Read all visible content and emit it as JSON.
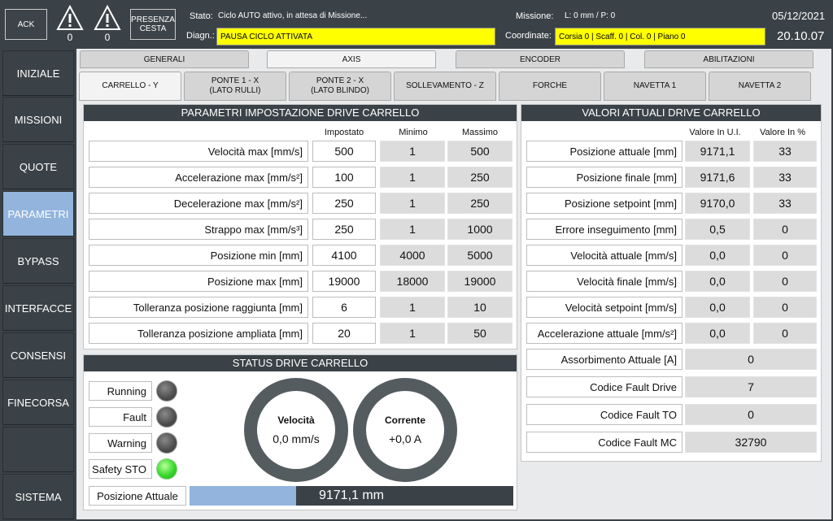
{
  "header": {
    "ack_label": "ACK",
    "warn1_count": "0",
    "warn2_count": "0",
    "presenza_line1": "PRESENZA",
    "presenza_line2": "CESTA",
    "stato_label": "Stato:",
    "stato_value": "Ciclo AUTO attivo, in attesa di Missione...",
    "diagn_label": "Diagn.:",
    "diagn_value": "PAUSA CICLO ATTIVATA",
    "missione_label": "Missione:",
    "missione_value": "L: 0 mm / P: 0",
    "coordinate_label": "Coordinate:",
    "coordinate_value": "Corsia 0 | Scaff. 0 | Col. 0 | Piano 0",
    "date": "05/12/2021",
    "time": "20.10.07"
  },
  "sidebar": {
    "items": [
      {
        "label": "INIZIALE"
      },
      {
        "label": "MISSIONI"
      },
      {
        "label": "QUOTE"
      },
      {
        "label": "PARAMETRI"
      },
      {
        "label": "BYPASS"
      },
      {
        "label": "INTERFACCE"
      },
      {
        "label": "CONSENSI"
      },
      {
        "label": "FINECORSA"
      },
      {
        "label": ""
      },
      {
        "label": "SISTEMA"
      }
    ],
    "active": "PARAMETRI"
  },
  "tabs_top": [
    "GENERALI",
    "AXIS",
    "ENCODER",
    "ABILITAZIONI"
  ],
  "tabs_axis": [
    {
      "l1": "CARRELLO - Y",
      "l2": ""
    },
    {
      "l1": "PONTE 1 - X",
      "l2": "(LATO RULLI)"
    },
    {
      "l1": "PONTE 2 - X",
      "l2": "(LATO BLINDO)"
    },
    {
      "l1": "SOLLEVAMENTO - Z",
      "l2": ""
    },
    {
      "l1": "FORCHE",
      "l2": ""
    },
    {
      "l1": "NAVETTA 1",
      "l2": ""
    },
    {
      "l1": "NAVETTA 2",
      "l2": ""
    }
  ],
  "params": {
    "title": "PARAMETRI IMPOSTAZIONE DRIVE CARRELLO",
    "col_set": "Impostato",
    "col_min": "Minimo",
    "col_max": "Massimo",
    "rows": [
      {
        "label": "Velocità max [mm/s]",
        "set": "500",
        "min": "1",
        "max": "500"
      },
      {
        "label": "Accelerazione max [mm/s²]",
        "set": "100",
        "min": "1",
        "max": "250"
      },
      {
        "label": "Decelerazione max [mm/s²]",
        "set": "250",
        "min": "1",
        "max": "250"
      },
      {
        "label": "Strappo max [mm/s³]",
        "set": "250",
        "min": "1",
        "max": "1000"
      },
      {
        "label": "Posizione min [mm]",
        "set": "4100",
        "min": "4000",
        "max": "5000"
      },
      {
        "label": "Posizione max [mm]",
        "set": "19000",
        "min": "18000",
        "max": "19000"
      },
      {
        "label": "Tolleranza posizione raggiunta [mm]",
        "set": "6",
        "min": "1",
        "max": "10"
      },
      {
        "label": "Tolleranza posizione ampliata [mm]",
        "set": "20",
        "min": "1",
        "max": "50"
      }
    ]
  },
  "status": {
    "title": "STATUS DRIVE CARRELLO",
    "indicators": [
      {
        "label": "Running",
        "on": false
      },
      {
        "label": "Fault",
        "on": false
      },
      {
        "label": "Warning",
        "on": false
      },
      {
        "label": "Safety STO",
        "on": true
      }
    ],
    "gauge_speed_title": "Velocità",
    "gauge_speed_value": "0,0 mm/s",
    "gauge_current_title": "Corrente",
    "gauge_current_value": "+0,0 A",
    "position_label": "Posizione Attuale",
    "position_value": "9171,1 mm",
    "position_fraction": 0.33,
    "bar_color": "#92b4dd"
  },
  "actual": {
    "title": "VALORI ATTUALI DRIVE CARRELLO",
    "col_ui": "Valore In U.I.",
    "col_pct": "Valore In %",
    "rows": [
      {
        "label": "Posizione attuale [mm]",
        "ui": "9171,1",
        "pct": "33"
      },
      {
        "label": "Posizione finale [mm]",
        "ui": "9171,6",
        "pct": "33"
      },
      {
        "label": "Posizione setpoint [mm]",
        "ui": "9170,0",
        "pct": "33"
      },
      {
        "label": "Errore inseguimento [mm]",
        "ui": "0,5",
        "pct": "0"
      },
      {
        "label": "Velocità attuale [mm/s]",
        "ui": "0,0",
        "pct": "0"
      },
      {
        "label": "Velocità finale [mm/s]",
        "ui": "0,0",
        "pct": "0"
      },
      {
        "label": "Velocità setpoint [mm/s]",
        "ui": "0,0",
        "pct": "0"
      },
      {
        "label": "Accelerazione attuale [mm/s²]",
        "ui": "0,0",
        "pct": "0"
      }
    ],
    "single_rows": [
      {
        "label": "Assorbimento Attuale [A]",
        "value": "0"
      },
      {
        "label": "Codice Fault Drive",
        "value": "7"
      },
      {
        "label": "Codice Fault TO",
        "value": "0"
      },
      {
        "label": "Codice Fault MC",
        "value": "32790"
      }
    ]
  }
}
